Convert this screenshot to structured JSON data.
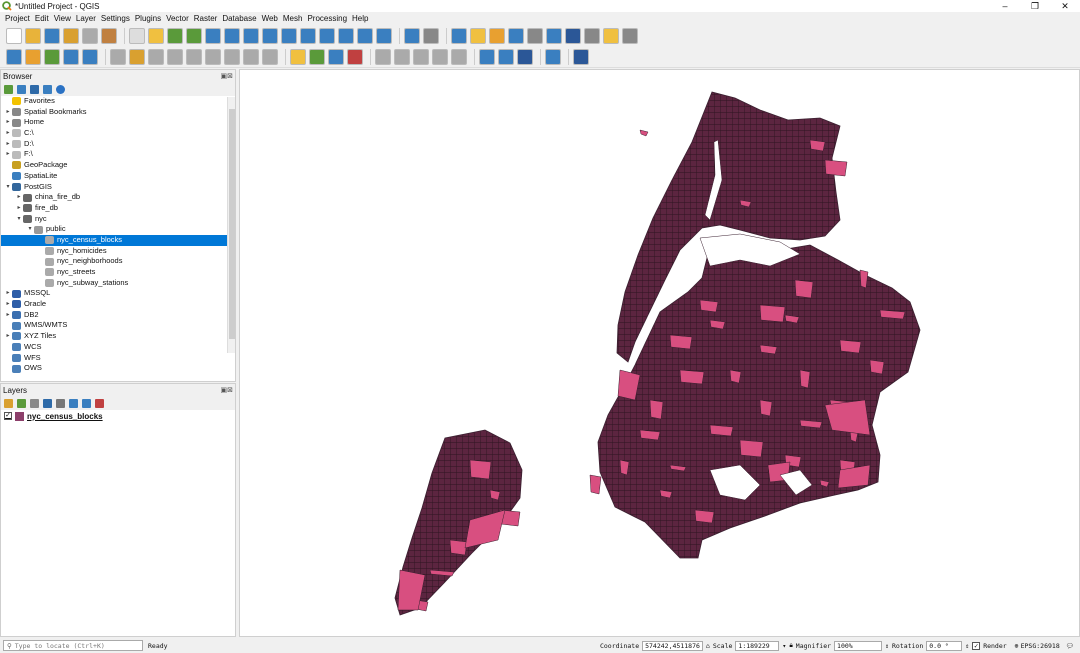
{
  "window": {
    "title": "*Untitled Project - QGIS"
  },
  "menu": [
    "Project",
    "Edit",
    "View",
    "Layer",
    "Settings",
    "Plugins",
    "Vector",
    "Raster",
    "Database",
    "Web",
    "Mesh",
    "Processing",
    "Help"
  ],
  "browser": {
    "title": "Browser",
    "items": [
      {
        "label": "Favorites",
        "indent": 0,
        "arrow": "",
        "icon": "star-icon",
        "color": "#f2c200"
      },
      {
        "label": "Spatial Bookmarks",
        "indent": 0,
        "arrow": "▸",
        "icon": "bookmark-icon",
        "color": "#888"
      },
      {
        "label": "Home",
        "indent": 0,
        "arrow": "▸",
        "icon": "home-icon",
        "color": "#888"
      },
      {
        "label": "C:\\",
        "indent": 0,
        "arrow": "▸",
        "icon": "drive-icon",
        "color": "#bbb"
      },
      {
        "label": "D:\\",
        "indent": 0,
        "arrow": "▸",
        "icon": "drive-icon",
        "color": "#bbb"
      },
      {
        "label": "F:\\",
        "indent": 0,
        "arrow": "▸",
        "icon": "drive-icon",
        "color": "#bbb"
      },
      {
        "label": "GeoPackage",
        "indent": 0,
        "arrow": "",
        "icon": "geopackage-icon",
        "color": "#c8a020"
      },
      {
        "label": "SpatiaLite",
        "indent": 0,
        "arrow": "",
        "icon": "spatialite-icon",
        "color": "#3a7fc0"
      },
      {
        "label": "PostGIS",
        "indent": 0,
        "arrow": "▾",
        "icon": "postgis-icon",
        "color": "#33679c"
      },
      {
        "label": "china_fire_db",
        "indent": 1,
        "arrow": "▸",
        "icon": "schema-icon",
        "color": "#666"
      },
      {
        "label": "fire_db",
        "indent": 1,
        "arrow": "▸",
        "icon": "schema-icon",
        "color": "#666"
      },
      {
        "label": "nyc",
        "indent": 1,
        "arrow": "▾",
        "icon": "schema-icon",
        "color": "#666"
      },
      {
        "label": "public",
        "indent": 2,
        "arrow": "▾",
        "icon": "table-icon",
        "color": "#999"
      },
      {
        "label": "nyc_census_blocks",
        "indent": 3,
        "arrow": "",
        "icon": "polygon-icon",
        "color": "#aaa",
        "selected": true
      },
      {
        "label": "nyc_homicides",
        "indent": 3,
        "arrow": "",
        "icon": "point-icon",
        "color": "#aaa"
      },
      {
        "label": "nyc_neighborhoods",
        "indent": 3,
        "arrow": "",
        "icon": "polygon-icon",
        "color": "#aaa"
      },
      {
        "label": "nyc_streets",
        "indent": 3,
        "arrow": "",
        "icon": "line-icon",
        "color": "#aaa"
      },
      {
        "label": "nyc_subway_stations",
        "indent": 3,
        "arrow": "",
        "icon": "point-icon",
        "color": "#aaa"
      },
      {
        "label": "MSSQL",
        "indent": 0,
        "arrow": "▸",
        "icon": "mssql-icon",
        "color": "#2e5ea8"
      },
      {
        "label": "Oracle",
        "indent": 0,
        "arrow": "▸",
        "icon": "oracle-icon",
        "color": "#2e5ea8"
      },
      {
        "label": "DB2",
        "indent": 0,
        "arrow": "▸",
        "icon": "db2-icon",
        "color": "#3a6fb0"
      },
      {
        "label": "WMS/WMTS",
        "indent": 0,
        "arrow": "",
        "icon": "globe-icon",
        "color": "#4a7fb8"
      },
      {
        "label": "XYZ Tiles",
        "indent": 0,
        "arrow": "▸",
        "icon": "globe-icon",
        "color": "#4a7fb8"
      },
      {
        "label": "WCS",
        "indent": 0,
        "arrow": "",
        "icon": "globe-icon",
        "color": "#4a7fb8"
      },
      {
        "label": "WFS",
        "indent": 0,
        "arrow": "",
        "icon": "globe-icon",
        "color": "#4a7fb8"
      },
      {
        "label": "OWS",
        "indent": 0,
        "arrow": "",
        "icon": "globe-icon",
        "color": "#4a7fb8"
      }
    ]
  },
  "layers": {
    "title": "Layers",
    "items": [
      {
        "label": "nyc_census_blocks",
        "checked": "✓",
        "fill": "#8c3f6a"
      }
    ]
  },
  "map": {
    "fill": "#d84f80",
    "stroke": "#3a2030",
    "block_fill": "#5c2540"
  },
  "status": {
    "locator_placeholder": "Type to locate (Ctrl+K)",
    "ready": "Ready",
    "coordinate_label": "Coordinate",
    "coordinate": "574242,4511876",
    "scale_label": "Scale",
    "scale": "1:189229",
    "magnifier_label": "Magnifier",
    "magnifier": "100%",
    "rotation_label": "Rotation",
    "rotation": "0.0 °",
    "render_label": "Render",
    "crs": "EPSG:26918"
  }
}
